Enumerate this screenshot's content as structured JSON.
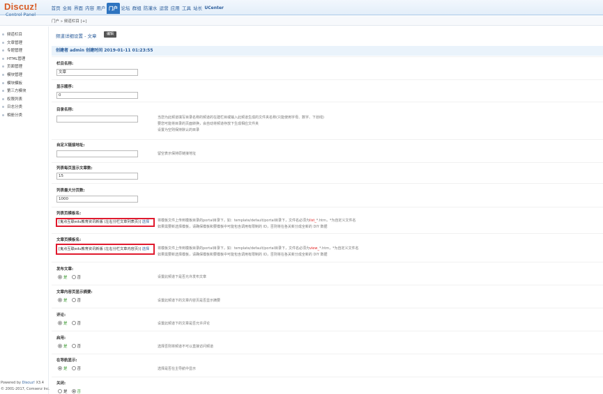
{
  "header": {
    "brand": "Discuz!",
    "control_panel": "Control Panel",
    "nav": [
      "首页",
      "全局",
      "界面",
      "内容",
      "用户",
      "门户",
      "论坛",
      "群组",
      "防灌水",
      "运营",
      "应用",
      "工具",
      "站长",
      "UCenter"
    ],
    "active_nav": "门户"
  },
  "breadcrumb": "门户 » 频道栏目 [+]",
  "sidebar": {
    "items": [
      "频道栏目",
      "文章管理",
      "专题管理",
      "HTML管理",
      "页面管理",
      "模块管理",
      "模块模板",
      "第三方模块",
      "权限列表",
      "日志分类",
      "相册分类"
    ],
    "powered_prefix": "Powered by ",
    "powered_link": "Discuz!",
    "powered_version": " X3.4",
    "copyright": "© 2001-2017, Comsenz Inc."
  },
  "page": {
    "title": "频道详细设置 - 文章",
    "edit_label": "编辑",
    "creator": "创建者 admin 创建时间 2019-01-11 01:23:55"
  },
  "form": {
    "catname_label": "栏目名称:",
    "catname_value": "文章",
    "displayorder_label": "显示顺序:",
    "displayorder_value": "0",
    "foldername_label": "目录名称:",
    "foldername_value": "",
    "foldername_tip1": "当您为此频道填写目录名称的频道的在建栏目或输入此频道生成的文件夹名称(只能使用字母、数字、下划线)",
    "foldername_tip2": "要您可能将目录的页面转换，会自动将频道存放下生成相应文件夹",
    "foldername_tip3": "设置为空则保持默认的目录",
    "domain_label": "自定义链接地址:",
    "domain_value": "",
    "domain_tip": "留空表示保持原链接地址",
    "perpage_label": "列表每页显示文章数:",
    "perpage_value": "15",
    "maxpages_label": "列表最大分页数:",
    "maxpages_value": "1000",
    "listtpl_label": "列表页模板名:",
    "listtpl_value": "[鬼点互联edu教育资讯新版 (左右分栏文章列表页)]",
    "listtpl_select": "选择",
    "listtpl_tip1_pre": "将模板文件上传到模板目录的portal目录下，如：template/default/portal目录下，文件名必须为",
    "listtpl_tip1_red": "list_",
    "listtpl_tip1_post": "*.htm，*为自定义文件名",
    "listtpl_tip2": "如果需要新选择模板，请确保模板和要模板中可能包含调用有限制的 ID，否则将在各关新分成全新的 DIY 数据",
    "viewtpl_label": "文章页模板名:",
    "viewtpl_value": "[鬼点互联edu教育资讯新版 (左右分栏文章内容页)]",
    "viewtpl_select": "选择",
    "viewtpl_tip1_pre": "将模板文件上传到模板目录的portal目录下，如：template/default/portal目录下，文件名必须为",
    "viewtpl_tip1_red": "view_",
    "viewtpl_tip1_post": "*.htm，*为自定义文件名",
    "viewtpl_tip2": "如果需要新选择模板，请确保模板和要模板中可能包含调用有限制的 ID，否则将在各关新分成全新的 DIY 数据",
    "publish_label": "发布文章:",
    "publish_tip": "设置此频道下是否允许发布文章",
    "summary_label": "文章内容页显示摘要:",
    "summary_tip": "设置此频道下的文章内容页是否显示摘要",
    "comment_label": "评论:",
    "comment_tip": "设置此频道下的文章是否允许评论",
    "enable_label": "启用:",
    "enable_tip": "选择否则将频道不可以直接访问频道",
    "navshow_label": "在导航显示:",
    "navshow_tip": "选择是否在主导航中显示",
    "close_label": "关闭:",
    "yes": "是",
    "no": "否"
  },
  "colors": {
    "accent": "#2e74c0",
    "highlight": "#e0192d",
    "brand": "#d85b24"
  }
}
